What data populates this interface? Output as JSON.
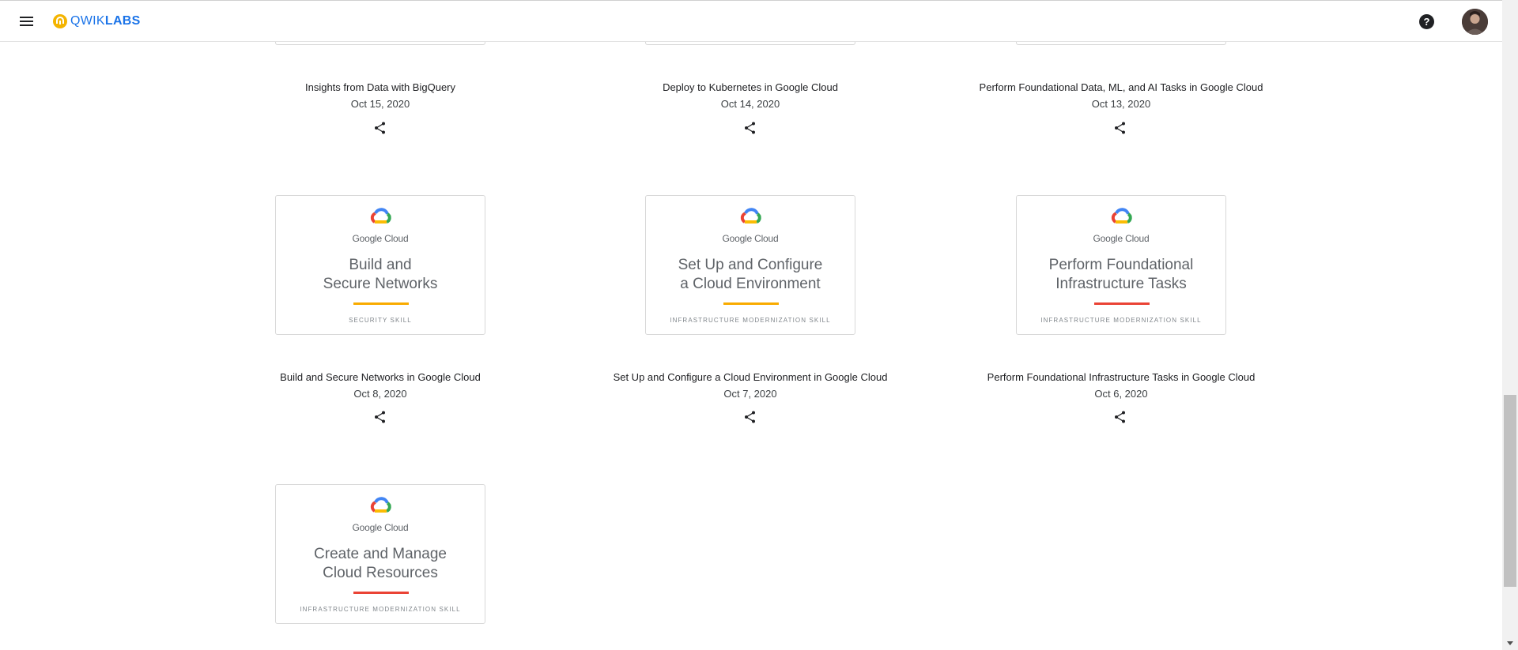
{
  "header": {
    "logo_prefix": "QWIK",
    "logo_suffix": "LABS",
    "help_icon_glyph": "?",
    "accent": "#1a73e8"
  },
  "prev_row": [
    {
      "title": "Insights from Data with BigQuery",
      "date": "Oct 15, 2020"
    },
    {
      "title": "Deploy to Kubernetes in Google Cloud",
      "date": "Oct 14, 2020"
    },
    {
      "title": "Perform Foundational Data, ML, and AI Tasks in Google Cloud",
      "date": "Oct 13, 2020"
    }
  ],
  "badges": [
    {
      "brand": "Google Cloud",
      "line1": "Build and",
      "line2": "Secure Networks",
      "skill": "SECURITY SKILL",
      "line_color": "#f9ab00",
      "title": "Build and Secure Networks in Google Cloud",
      "date": "Oct 8, 2020"
    },
    {
      "brand": "Google Cloud",
      "line1": "Set Up and Configure",
      "line2": "a Cloud Environment",
      "skill": "INFRASTRUCTURE MODERNIZATION SKILL",
      "line_color": "#f9ab00",
      "title": "Set Up and Configure a Cloud Environment in Google Cloud",
      "date": "Oct 7, 2020"
    },
    {
      "brand": "Google Cloud",
      "line1": "Perform Foundational",
      "line2": "Infrastructure Tasks",
      "skill": "INFRASTRUCTURE MODERNIZATION SKILL",
      "line_color": "#ea4335",
      "title": "Perform Foundational Infrastructure Tasks in Google Cloud",
      "date": "Oct 6, 2020"
    },
    {
      "brand": "Google Cloud",
      "line1": "Create and Manage",
      "line2": "Cloud Resources",
      "skill": "INFRASTRUCTURE MODERNIZATION SKILL",
      "line_color": "#ea4335"
    }
  ]
}
